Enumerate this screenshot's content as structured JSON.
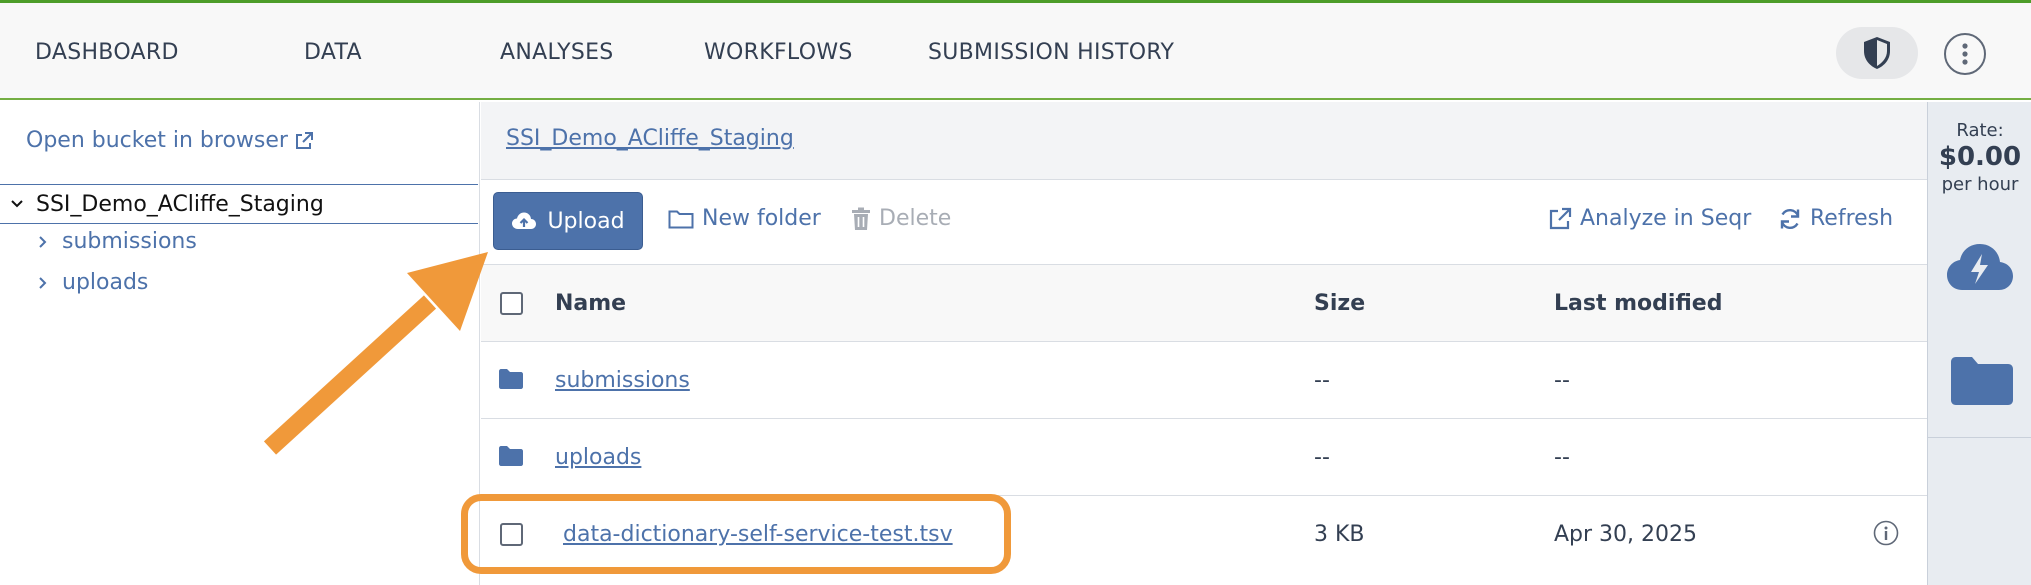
{
  "nav": {
    "items": [
      "DASHBOARD",
      "DATA",
      "ANALYSES",
      "WORKFLOWS",
      "SUBMISSION HISTORY"
    ],
    "shield_icon": "shield-icon",
    "menu_icon": "kebab-menu-icon"
  },
  "sidebar": {
    "open_bucket": "Open bucket in browser",
    "root": "SSI_Demo_ACliffe_Staging",
    "children": [
      "submissions",
      "uploads"
    ]
  },
  "main": {
    "breadcrumb": "SSI_Demo_ACliffe_Staging",
    "toolbar": {
      "upload": "Upload",
      "new_folder": "New folder",
      "delete": "Delete",
      "analyze": "Analyze in Seqr",
      "refresh": "Refresh"
    },
    "table": {
      "columns": [
        "Name",
        "Size",
        "Last modified"
      ],
      "rows": [
        {
          "name": "submissions",
          "size": "--",
          "modified": "--",
          "kind": "folder"
        },
        {
          "name": "uploads",
          "size": "--",
          "modified": "--",
          "kind": "folder"
        },
        {
          "name": "data-dictionary-self-service-test.tsv",
          "size": "3 KB",
          "modified": "Apr 30, 2025",
          "kind": "file"
        }
      ]
    }
  },
  "rail": {
    "rate_label": "Rate:",
    "rate_value": "$0.00",
    "rate_unit": "per hour"
  },
  "colors": {
    "accent": "#4d72aa",
    "nav_border": "#74ae43",
    "annotation": "#f0993a"
  }
}
